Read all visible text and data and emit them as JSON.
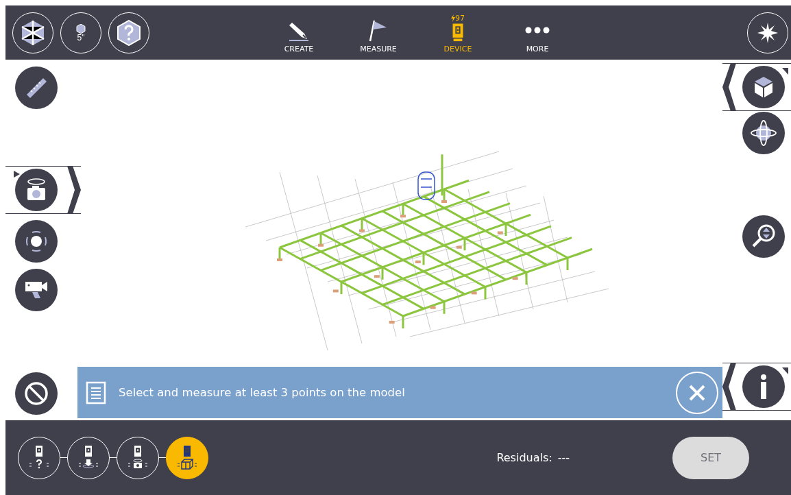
{
  "toolbar": {
    "scale_label": "5\"",
    "nav": [
      {
        "kind": "create",
        "label": "CREATE",
        "selected": false
      },
      {
        "kind": "measure",
        "label": "MEASURE",
        "selected": false
      },
      {
        "kind": "device",
        "label": "DEVICE",
        "selected": true,
        "battery": "97"
      },
      {
        "kind": "more",
        "label": "MORE",
        "selected": false
      }
    ]
  },
  "side_panels": {
    "camera_tab": {
      "expanded": true
    },
    "view_tab": {
      "expanded": true
    },
    "info_tab": {
      "expanded": true
    }
  },
  "banner": {
    "message": "Select and measure at least 3 points on the model"
  },
  "steps": [
    {
      "kind": "unknown",
      "selected": false
    },
    {
      "kind": "point",
      "selected": false
    },
    {
      "kind": "camera",
      "selected": false
    },
    {
      "kind": "model",
      "selected": true
    }
  ],
  "residuals": {
    "label": "Residuals:",
    "value": "---"
  },
  "set_button": {
    "label": "SET",
    "disabled": true
  }
}
